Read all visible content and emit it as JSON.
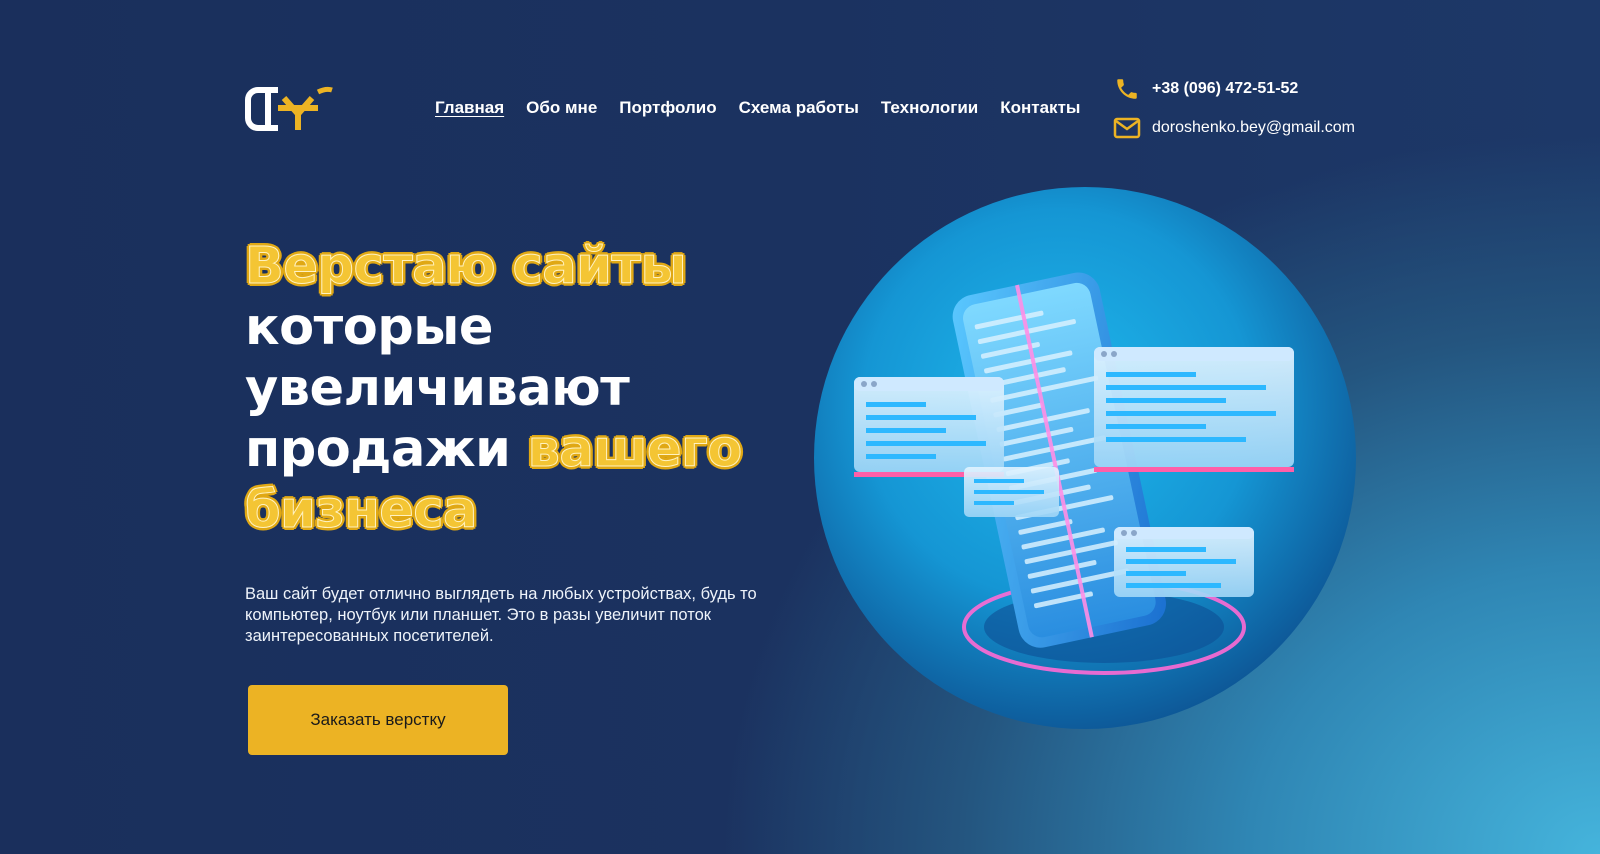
{
  "header": {
    "logo": {
      "icon": "logo-icon",
      "letters": "CHY"
    },
    "nav": [
      {
        "label": "Главная",
        "active": true
      },
      {
        "label": "Обо мне"
      },
      {
        "label": "Портфолио"
      },
      {
        "label": "Схема работы"
      },
      {
        "label": "Технологии"
      },
      {
        "label": "Контакты"
      }
    ],
    "contacts": {
      "phone": {
        "icon": "phone-icon",
        "text": "+38 (096) 472-51-52"
      },
      "email": {
        "icon": "mail-icon",
        "text": "doroshenko.bey@gmail.com"
      }
    }
  },
  "hero": {
    "title": {
      "l1": "Верстаю сайты",
      "l2": "которые",
      "l3": "увеличивают",
      "l4_plain": "продажи",
      "l4_highlight": "вашего",
      "l5": "бизнеса"
    },
    "description": "Ваш сайт будет отлично выглядеть на любых устройствах, будь то компьютер, ноутбук или планшет. Это в разы увеличит поток заинтересованных посетителей.",
    "cta_label": "Заказать верстку",
    "illustration": "phone-with-code-windows-illustration"
  },
  "colors": {
    "accent": "#ecb324",
    "background_dark": "#1a2f5c",
    "background_light": "#45b4dc",
    "text": "#ffffff"
  }
}
